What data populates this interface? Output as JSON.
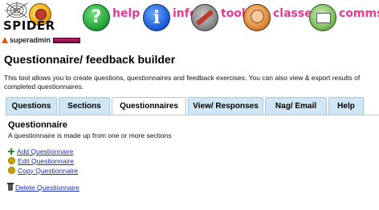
{
  "logo": {
    "text": "SPIDER"
  },
  "nav": [
    {
      "label": "help",
      "icon": "help-icon",
      "glyph": "?"
    },
    {
      "label": "info",
      "icon": "info-icon",
      "glyph": "i"
    },
    {
      "label": "tools",
      "icon": "tools-icon"
    },
    {
      "label": "classes",
      "icon": "classes-icon"
    },
    {
      "label": "comms",
      "icon": "comms-icon"
    }
  ],
  "user": {
    "name": "superadmin"
  },
  "page": {
    "title": "Questionnaire/ feedback builder",
    "description": "This tool allows you to create questions, questionnaires and feedback exercises. You can also view & export results of completed questionnaires."
  },
  "tabs": [
    {
      "label": "Questions",
      "active": false
    },
    {
      "label": "Sections",
      "active": false
    },
    {
      "label": "Questionnaires",
      "active": true
    },
    {
      "label": "View/ Responses",
      "active": false
    },
    {
      "label": "Nag/ Email",
      "active": false
    },
    {
      "label": "Help",
      "active": false
    }
  ],
  "panel": {
    "title": "Questionnaire",
    "subtitle": "A questionnaire is made up from one or more sections",
    "actions": [
      {
        "label": "Add Questionnaire",
        "icon": "plus-icon"
      },
      {
        "label": "Edit Questionnaire",
        "icon": "gear-icon"
      },
      {
        "label": "Copy Questionnaire",
        "icon": "gear-icon"
      },
      {
        "label": "Delete Questionnaire",
        "icon": "trash-icon"
      }
    ]
  },
  "colors": {
    "nav_label": "#e63a93",
    "tab_bg": "#cfe6f5",
    "link": "#1a2fb5"
  }
}
